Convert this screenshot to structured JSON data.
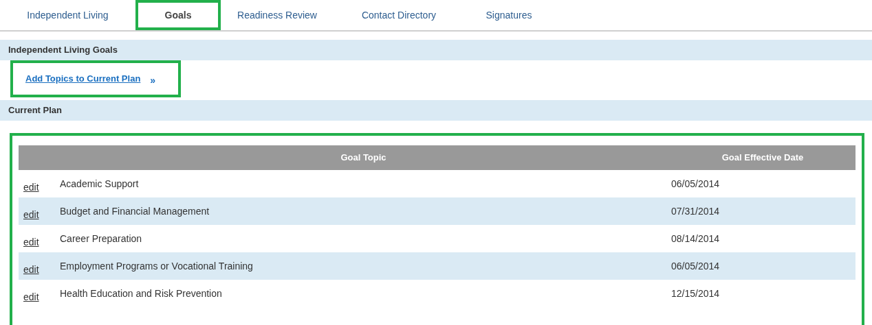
{
  "tabs": [
    {
      "label": "Independent Living",
      "selected": false,
      "highlighted": false
    },
    {
      "label": "Goals",
      "selected": true,
      "highlighted": true
    },
    {
      "label": "Readiness Review",
      "selected": false,
      "highlighted": false
    },
    {
      "label": "Contact Directory",
      "selected": false,
      "highlighted": false
    },
    {
      "label": "Signatures",
      "selected": false,
      "highlighted": false
    }
  ],
  "goals_section": {
    "title": "Independent Living Goals",
    "link": {
      "label": "Add Topics to Current Plan",
      "icon": "»",
      "highlighted": true
    }
  },
  "current_plan": {
    "title": "Current Plan",
    "highlighted": true,
    "table": {
      "columns": [
        "Goal Topic",
        "Goal Effective Date"
      ],
      "rows": [
        {
          "action": "edit",
          "topic": "Academic Support",
          "date": "06/05/2014"
        },
        {
          "action": "edit",
          "topic": "Budget and Financial  Management",
          "date": "07/31/2014"
        },
        {
          "action": "edit",
          "topic": "Career Preparation",
          "date": "08/14/2014"
        },
        {
          "action": "edit",
          "topic": "Employment Programs or Vocational Training",
          "date": "06/05/2014"
        },
        {
          "action": "edit",
          "topic": "Health Education and Risk Prevention",
          "date": "12/15/2014"
        }
      ]
    }
  }
}
